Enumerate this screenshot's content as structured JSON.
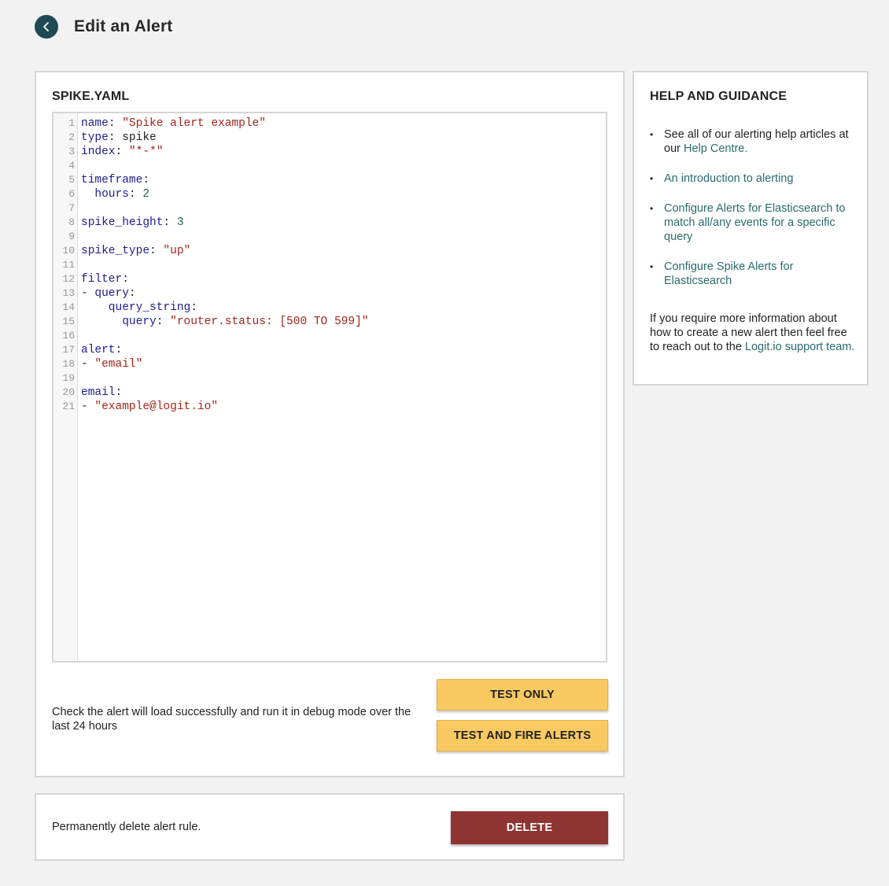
{
  "header": {
    "title": "Edit an Alert"
  },
  "editor": {
    "title": "SPIKE.YAML",
    "lines": [
      [
        {
          "t": "name",
          "c": "k"
        },
        {
          "t": ": ",
          "c": "p"
        },
        {
          "t": "\"Spike alert example\"",
          "c": "s"
        }
      ],
      [
        {
          "t": "type",
          "c": "k"
        },
        {
          "t": ": spike",
          "c": "p"
        }
      ],
      [
        {
          "t": "index",
          "c": "k"
        },
        {
          "t": ": ",
          "c": "p"
        },
        {
          "t": "\"*-*\"",
          "c": "s"
        }
      ],
      [],
      [
        {
          "t": "timeframe",
          "c": "k"
        },
        {
          "t": ":",
          "c": "p"
        }
      ],
      [
        {
          "t": "  hours",
          "c": "k"
        },
        {
          "t": ": ",
          "c": "p"
        },
        {
          "t": "2",
          "c": "n"
        }
      ],
      [],
      [
        {
          "t": "spike_height",
          "c": "k"
        },
        {
          "t": ": ",
          "c": "p"
        },
        {
          "t": "3",
          "c": "n"
        }
      ],
      [],
      [
        {
          "t": "spike_type",
          "c": "k"
        },
        {
          "t": ": ",
          "c": "p"
        },
        {
          "t": "\"up\"",
          "c": "s"
        }
      ],
      [],
      [
        {
          "t": "filter",
          "c": "k"
        },
        {
          "t": ":",
          "c": "p"
        }
      ],
      [
        {
          "t": "- ",
          "c": "p"
        },
        {
          "t": "query",
          "c": "k"
        },
        {
          "t": ":",
          "c": "p"
        }
      ],
      [
        {
          "t": "    query_string",
          "c": "k"
        },
        {
          "t": ":",
          "c": "p"
        }
      ],
      [
        {
          "t": "      query",
          "c": "k"
        },
        {
          "t": ": ",
          "c": "p"
        },
        {
          "t": "\"router.status: [500 TO 599]\"",
          "c": "s"
        }
      ],
      [],
      [
        {
          "t": "alert",
          "c": "k"
        },
        {
          "t": ":",
          "c": "p"
        }
      ],
      [
        {
          "t": "- ",
          "c": "p"
        },
        {
          "t": "\"email\"",
          "c": "s"
        }
      ],
      [],
      [
        {
          "t": "email",
          "c": "k"
        },
        {
          "t": ":",
          "c": "p"
        }
      ],
      [
        {
          "t": "- ",
          "c": "p"
        },
        {
          "t": "\"example@logit.io\"",
          "c": "s"
        }
      ]
    ]
  },
  "actions": {
    "description": "Check the alert will load successfully and run it in debug mode over the last 24 hours",
    "test_only_label": "TEST ONLY",
    "test_fire_label": "TEST AND FIRE ALERTS"
  },
  "delete_section": {
    "description": "Permanently delete alert rule.",
    "delete_label": "DELETE"
  },
  "help": {
    "title": "HELP AND GUIDANCE",
    "item1_prefix": "See all of our alerting help articles at our ",
    "item1_link": "Help Centre",
    "item1_suffix": ".",
    "item2_link": "An introduction to alerting",
    "item3_link": "Configure Alerts for Elasticsearch to match all/any events for a specific query",
    "item4_link": "Configure Spike Alerts for Elasticsearch",
    "footer_prefix": "If you require more information about how to create a new alert then feel free to reach out to the ",
    "footer_link": "Logit.io support team",
    "footer_suffix": "."
  }
}
